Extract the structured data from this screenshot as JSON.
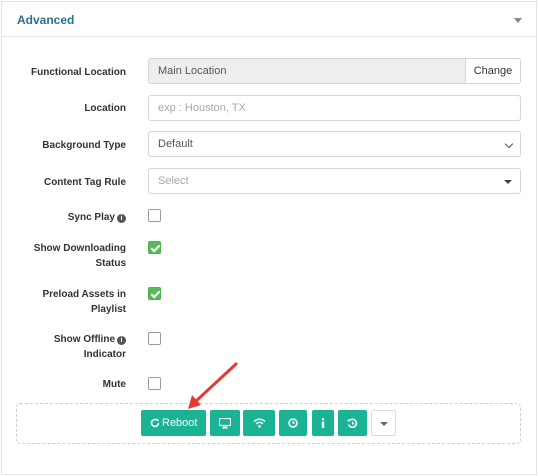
{
  "panel": {
    "title": "Advanced",
    "caret_icon": "caret-down-icon"
  },
  "form": {
    "functional_location": {
      "label": "Functional Location",
      "value": "Main Location",
      "change_label": "Change"
    },
    "location": {
      "label": "Location",
      "placeholder": "exp : Houston, TX"
    },
    "background_type": {
      "label": "Background Type",
      "selected": "Default"
    },
    "content_tag_rule": {
      "label": "Content Tag Rule",
      "placeholder": "Select"
    },
    "sync_play": {
      "label": "Sync Play",
      "checked": false,
      "info_icon": "info-icon"
    },
    "show_downloading_status": {
      "label_line1": "Show Downloading",
      "label_line2": "Status",
      "checked": true
    },
    "preload_assets": {
      "label_line1": "Preload Assets in",
      "label_line2": "Playlist",
      "checked": true
    },
    "show_offline_indicator": {
      "label_line1": "Show Offline",
      "label_line2": "Indicator",
      "checked": false,
      "info_icon": "info-icon"
    },
    "mute": {
      "label": "Mute",
      "checked": false
    }
  },
  "toolbar": {
    "reboot_label": "Reboot",
    "buttons": [
      {
        "name": "reboot-button",
        "icon": "refresh-icon"
      },
      {
        "name": "screen-button",
        "icon": "monitor-icon"
      },
      {
        "name": "wifi-button",
        "icon": "wifi-icon"
      },
      {
        "name": "clock-button",
        "icon": "clock-icon"
      },
      {
        "name": "info-button",
        "icon": "info-icon"
      },
      {
        "name": "history-button",
        "icon": "history-icon"
      },
      {
        "name": "more-dropdown-button",
        "icon": "caret-down-icon"
      }
    ]
  },
  "colors": {
    "accent": "#1ab394",
    "checkbox_checked": "#5cb85c",
    "title": "#2e6e8e",
    "annotation_arrow": "#e03c31"
  }
}
